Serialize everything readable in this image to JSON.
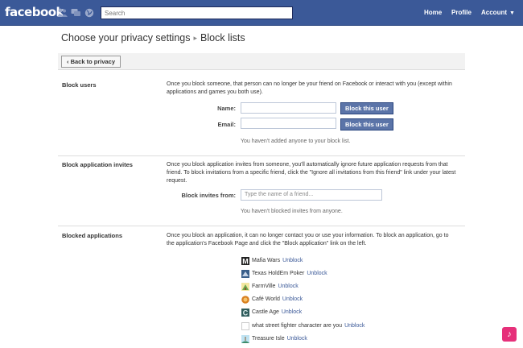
{
  "topbar": {
    "logo": "facebook",
    "search_placeholder": "Search",
    "nav": {
      "home": "Home",
      "profile": "Profile",
      "account": "Account"
    }
  },
  "page": {
    "title": "Choose your privacy settings",
    "separator": "▸",
    "subtitle": "Block lists",
    "back_button": "‹ Back to privacy"
  },
  "block_users": {
    "heading": "Block users",
    "description": "Once you block someone, that person can no longer be your friend on Facebook or interact with you (except within applications and games you both use).",
    "name_label": "Name:",
    "email_label": "Email:",
    "button": "Block this user",
    "note": "You haven't added anyone to your block list."
  },
  "block_invites": {
    "heading": "Block application invites",
    "description": "Once you block application invites from someone, you'll automatically ignore future application requests from that friend. To block invitations from a specific friend, click the \"Ignore all invitations from this friend\" link under your latest request.",
    "field_label": "Block invites from:",
    "placeholder": "Type the name of a friend...",
    "note": "You haven't blocked invites from anyone."
  },
  "blocked_apps": {
    "heading": "Blocked applications",
    "description": "Once you block an application, it can no longer contact you or use your information. To block an application, go to the application's Facebook Page and click the \"Block application\" link on the left.",
    "unblock": "Unblock",
    "apps": [
      {
        "name": "Mafia Wars",
        "icon": "mafia-wars-icon",
        "color": "#222222"
      },
      {
        "name": "Texas HoldEm Poker",
        "icon": "poker-icon",
        "color": "#3a5f8a"
      },
      {
        "name": "FarmVille",
        "icon": "farmville-icon",
        "color": "#6aa84f"
      },
      {
        "name": "Café World",
        "icon": "cafe-world-icon",
        "color": "#d87f1f"
      },
      {
        "name": "Castle Age",
        "icon": "castle-age-icon",
        "color": "#2f5c5c"
      },
      {
        "name": "what street fighter character are you",
        "icon": "blank-app-icon",
        "color": "#ffffff"
      },
      {
        "name": "Treasure Isle",
        "icon": "treasure-isle-icon",
        "color": "#3c8c6c"
      }
    ]
  },
  "colors": {
    "brand": "#3b5998",
    "button": "#5b74a8",
    "link": "#3b5998"
  }
}
